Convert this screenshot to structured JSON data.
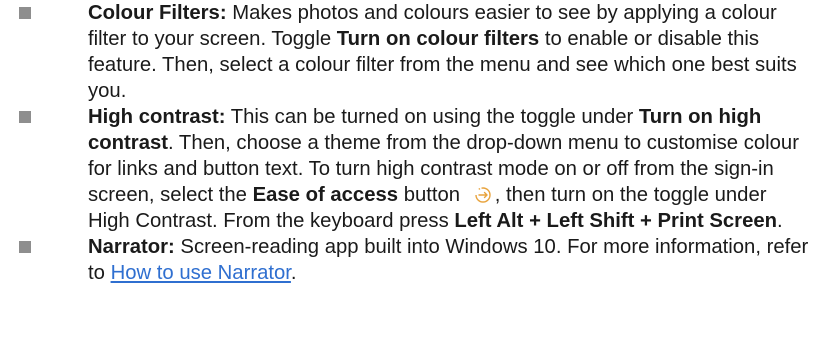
{
  "items": [
    {
      "heading": "Colour Filters:",
      "t1": " Makes photos and colours easier to see by applying a colour filter to your screen. Toggle ",
      "b1": "Turn on colour filters",
      "t2": " to enable or disable this feature. Then, select a colour filter from the menu and see which one best suits you."
    },
    {
      "heading": "High contrast:",
      "t1": " This can be turned on using the toggle under ",
      "b1": "Turn on high contrast",
      "t2": ". Then, choose a theme from the drop-down menu to customise colour for links and button text. To turn high contrast mode on or off from the sign-in screen, select the ",
      "b2": "Ease of access",
      "t3": " button ",
      "t4": ", then turn on the toggle under High Contrast. From the keyboard press ",
      "b3": "Left Alt + Left Shift + Print Screen",
      "t5": "."
    },
    {
      "heading": "Narrator:",
      "t1": " Screen-reading app built into Windows 10. For more information, refer to ",
      "link": "How to use Narrator",
      "t2": "."
    }
  ],
  "icons": {
    "bullet": "square-bullet",
    "ease_of_access": "ease-of-access-icon"
  },
  "colors": {
    "text": "#1a1a1a",
    "bullet": "#8e8e8e",
    "link": "#2f6fd0",
    "icon": "#e8a33d"
  }
}
